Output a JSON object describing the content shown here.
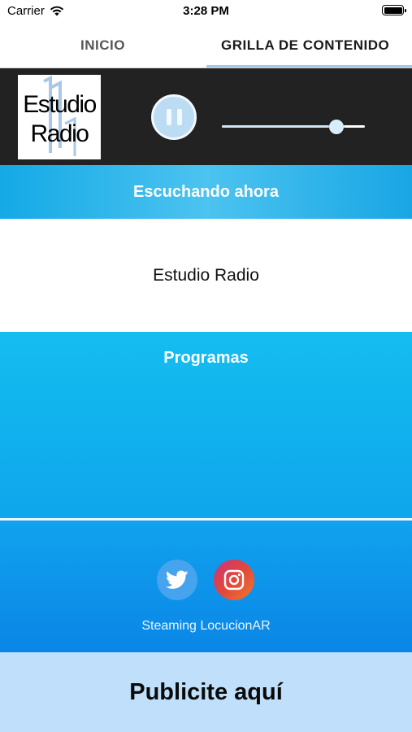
{
  "status_bar": {
    "carrier": "Carrier",
    "time": "3:28 PM",
    "wifi_icon": "wifi-icon",
    "battery_icon": "battery-icon"
  },
  "tabs": [
    {
      "label": "INICIO",
      "selected": false
    },
    {
      "label": "GRILLA DE CONTENIDO",
      "selected": true
    }
  ],
  "player": {
    "logo_line1": "Estudio",
    "logo_line2": "Radio",
    "pause_icon": "pause-icon",
    "volume_level": 0.8,
    "colors": {
      "background": "#222222",
      "button": "#bcdcf4"
    }
  },
  "now_playing": {
    "header": "Escuchando ahora",
    "station": "Estudio Radio"
  },
  "programs": {
    "header": "Programas"
  },
  "footer": {
    "social": [
      {
        "icon": "twitter-icon"
      },
      {
        "icon": "instagram-icon"
      }
    ],
    "credit": "Steaming LocucionAR"
  },
  "ad": {
    "label": "Publicite aquí"
  },
  "colors": {
    "accent": "#14a9e6",
    "ad_background": "#bfdffb"
  }
}
